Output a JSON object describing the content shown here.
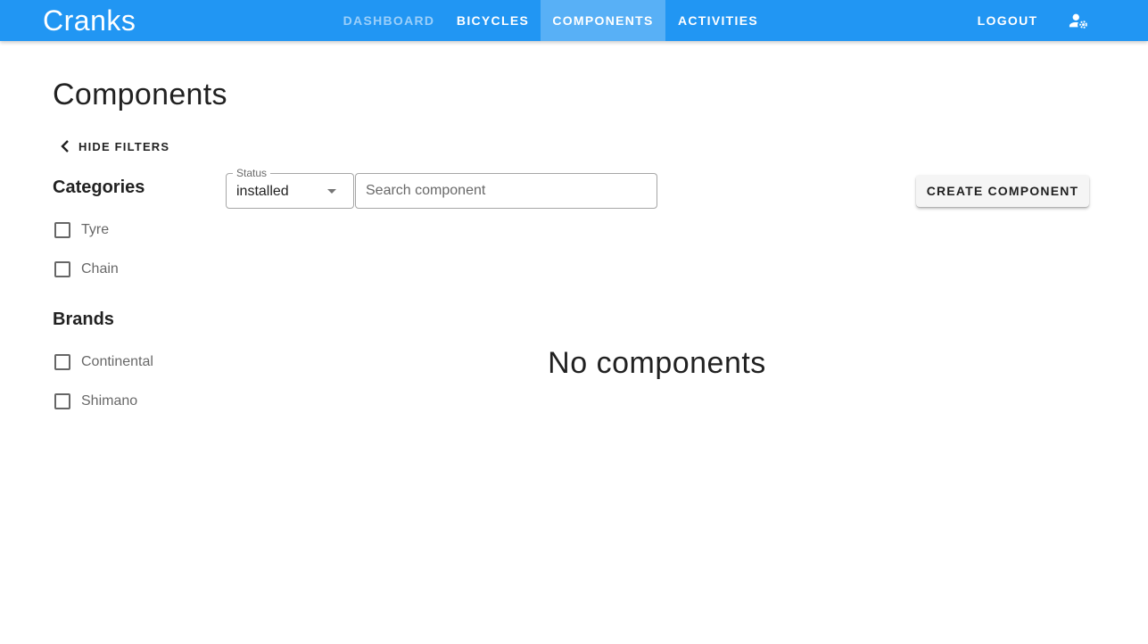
{
  "app": {
    "brand": "Cranks",
    "nav": [
      {
        "label": "DASHBOARD",
        "state": "disabled"
      },
      {
        "label": "BICYCLES",
        "state": "normal"
      },
      {
        "label": "COMPONENTS",
        "state": "active"
      },
      {
        "label": "ACTIVITIES",
        "state": "normal"
      }
    ],
    "logout_label": "LOGOUT",
    "account_icon": "account-cog-icon",
    "accent_color": "#2196f3"
  },
  "page": {
    "title": "Components",
    "hide_filters_label": "HIDE FILTERS"
  },
  "filters": {
    "categories": {
      "heading": "Categories",
      "options": [
        {
          "label": "Tyre",
          "checked": false
        },
        {
          "label": "Chain",
          "checked": false
        }
      ]
    },
    "brands": {
      "heading": "Brands",
      "options": [
        {
          "label": "Continental",
          "checked": false
        },
        {
          "label": "Shimano",
          "checked": false
        }
      ]
    }
  },
  "toolbar": {
    "status_label": "Status",
    "status_value": "installed",
    "search_placeholder": "Search component",
    "search_value": "",
    "create_label": "CREATE COMPONENT"
  },
  "results": {
    "empty_message": "No components"
  }
}
